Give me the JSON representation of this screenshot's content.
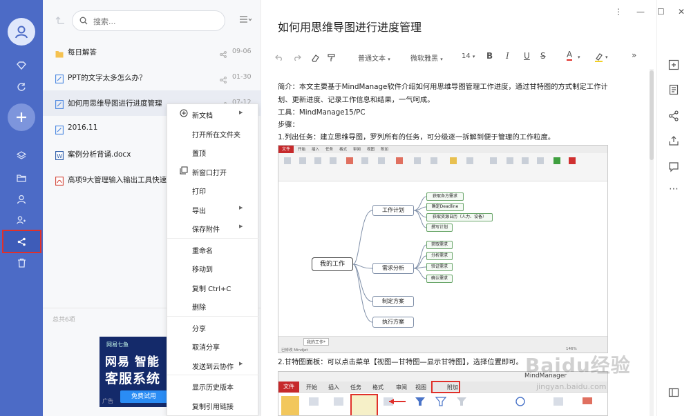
{
  "sidebar": {
    "items": [
      "avatar",
      "favorites",
      "sync",
      "add",
      "notes",
      "folders",
      "contacts",
      "team",
      "shared",
      "trash"
    ]
  },
  "list": {
    "search_placeholder": "搜索...",
    "files": [
      {
        "name": "每日解答",
        "date": "09-06",
        "type": "folder",
        "shared": true
      },
      {
        "name": "PPT的文字太多怎么办？",
        "date": "01-30",
        "type": "note",
        "shared": true
      },
      {
        "name": "如何用思维导图进行进度管理",
        "date": "07-12",
        "type": "note",
        "shared": true,
        "selected": true
      },
      {
        "name": "2016.11",
        "date": "",
        "type": "note",
        "shared": false
      },
      {
        "name": "案例分析背诵.docx",
        "date": "",
        "type": "word",
        "shared": false
      },
      {
        "name": "高项9大管理输入输出工具快速记忆",
        "date": "",
        "type": "pdf",
        "shared": false
      }
    ],
    "total": "总共6项",
    "ad": {
      "brand": "网易七鱼",
      "line1": "网易 智能",
      "line2": "客服系统",
      "button": "免费试用",
      "tag": "广告"
    }
  },
  "context_menu": {
    "items": [
      {
        "label": "新文档",
        "submenu": true,
        "icon": "plus-circle"
      },
      {
        "label": "打开所在文件夹"
      },
      {
        "label": "置顶"
      },
      {
        "label": "新窗口打开",
        "icon": "window"
      },
      {
        "label": "打印"
      },
      {
        "label": "导出",
        "submenu": true
      },
      {
        "label": "保存附件",
        "submenu": true
      },
      {
        "label": "重命名"
      },
      {
        "label": "移动到"
      },
      {
        "label": "复制 Ctrl+C"
      },
      {
        "label": "删除"
      },
      {
        "label": "分享"
      },
      {
        "label": "取消分享"
      },
      {
        "label": "发送到云协作",
        "submenu": true
      },
      {
        "label": "显示历史版本"
      },
      {
        "label": "复制引用链接"
      }
    ]
  },
  "editor": {
    "title": "如何用思维导图进行进度管理",
    "toolbar": {
      "style": "普通文本",
      "font": "微软雅黑",
      "size": "14",
      "bold": "B",
      "italic": "I",
      "underline": "U",
      "strike": "S",
      "font_color": "A",
      "more": "»"
    },
    "paragraphs": [
      "简介：本文主要基于MindManage软件介绍如何用思维导图管理工作进度，通过甘特图的方式制定工作计",
      "划、更新进度、记录工作信息和结果，一气呵成。",
      "工具：MindManage15/PC",
      "步骤：",
      "1.列出任务：建立思维导图，罗列所有的任务，可分级逐一拆解到便于管理的工作粒度。",
      "2.甘特图面板：可以点击菜单【视图—甘特图—显示甘特图】，选择位置即可。"
    ],
    "mindmap": {
      "ribbon_tabs": [
        "文件",
        "开始",
        "插入",
        "任务",
        "格式",
        "审阅",
        "视图",
        "附加"
      ],
      "center": "我的工作",
      "branches": [
        {
          "label": "工作计划",
          "leaves": [
            "获取各方需求",
            "确定Deadline",
            "获取资源日历（人力、设备）",
            "撰写计划"
          ]
        },
        {
          "label": "需求分析",
          "leaves": [
            "获取需求",
            "分析需求",
            "验证需求",
            "确认需求"
          ]
        },
        {
          "label": "制定方案",
          "leaves": []
        },
        {
          "label": "执行方案",
          "leaves": []
        }
      ],
      "sheet_tab": "我的工作*",
      "status": "已修改 Mindjet",
      "zoom": "146%"
    },
    "ribbon2": {
      "title": "MindManager",
      "tabs": [
        "文件",
        "开始",
        "插入",
        "任务",
        "格式",
        "审阅",
        "视图",
        "附加"
      ]
    }
  },
  "watermark": {
    "text": "Baidu经验",
    "url": "jingyan.baidu.com"
  },
  "colors": {
    "sidebar": "#4c6bc6",
    "highlight": "#e0302a",
    "ribbon_red": "#c6292b"
  }
}
